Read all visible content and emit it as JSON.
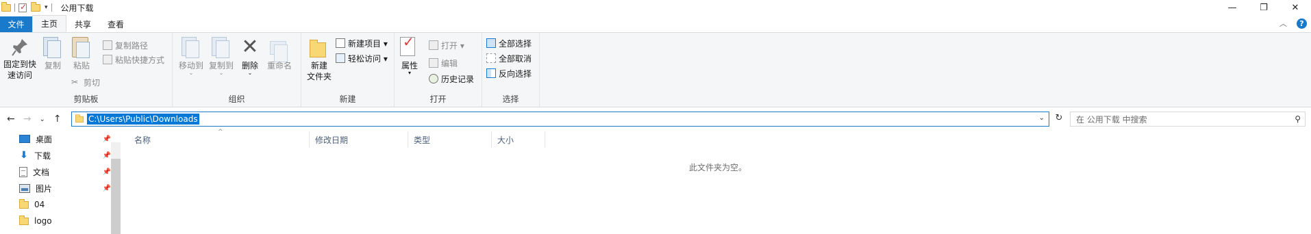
{
  "titlebar": {
    "title": "公用下载",
    "window_controls": {
      "minimize": "—",
      "restore": "❐",
      "close": "✕"
    }
  },
  "tabs": [
    {
      "label": "文件"
    },
    {
      "label": "主页"
    },
    {
      "label": "共享"
    },
    {
      "label": "查看"
    }
  ],
  "ribbon": {
    "clipboard": {
      "pin_label_1": "固定到快",
      "pin_label_2": "速访问",
      "copy": "复制",
      "paste": "粘贴",
      "copy_path": "复制路径",
      "paste_shortcut": "粘贴快捷方式",
      "cut": "剪切",
      "group": "剪贴板"
    },
    "organize": {
      "move_to": "移动到",
      "copy_to": "复制到",
      "delete": "删除",
      "rename": "重命名",
      "group": "组织"
    },
    "new": {
      "new_folder_1": "新建",
      "new_folder_2": "文件夹",
      "new_item": "新建项目 ▾",
      "easy_access": "轻松访问 ▾",
      "group": "新建"
    },
    "open": {
      "properties": "属性",
      "open": "打开 ▾",
      "edit": "编辑",
      "history": "历史记录",
      "group": "打开"
    },
    "select": {
      "select_all": "全部选择",
      "select_none": "全部取消",
      "invert": "反向选择",
      "group": "选择"
    }
  },
  "address": {
    "path": "C:\\Users\\Public\\Downloads",
    "search_placeholder": "在 公用下载 中搜索"
  },
  "navpane": {
    "items": [
      {
        "label": "桌面",
        "pinned": true
      },
      {
        "label": "下载",
        "pinned": true
      },
      {
        "label": "文档",
        "pinned": true
      },
      {
        "label": "图片",
        "pinned": true
      },
      {
        "label": "04",
        "pinned": false
      },
      {
        "label": "logo",
        "pinned": false
      }
    ]
  },
  "content": {
    "columns": [
      "名称",
      "修改日期",
      "类型",
      "大小"
    ],
    "empty_message": "此文件夹为空。"
  },
  "colors": {
    "accent": "#1979ca",
    "selection": "#0078d7",
    "folder": "#f8d775"
  }
}
